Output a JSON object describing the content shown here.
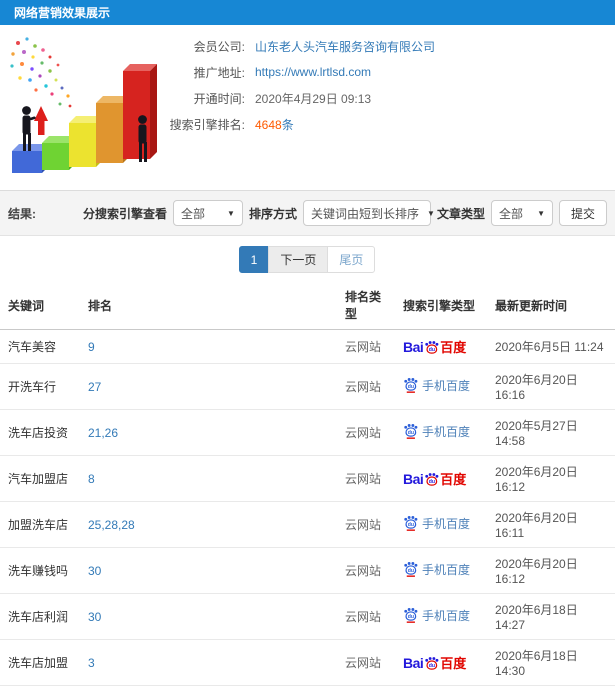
{
  "header": {
    "title": "网络营销效果展示"
  },
  "colors": {
    "topbar_blue": "#1787d4",
    "link_blue": "#337ab7",
    "count_orange": "#ff5a00",
    "baidu_blue": "#2319dc",
    "baidu_red": "#e10601",
    "mobile_icon_blue": "#2b5fd9"
  },
  "info": {
    "rows": [
      {
        "label": "会员公司:",
        "value": "山东老人头汽车服务咨询有限公司"
      },
      {
        "label": "推广地址:",
        "value": "https://www.lrtlsd.com"
      },
      {
        "label": "开通时间:",
        "value": "2020年4月29日 09:13"
      },
      {
        "label": "搜索引擎排名:",
        "value": "4648",
        "suffix": "条"
      }
    ]
  },
  "filters": {
    "result_label": "结果:",
    "engine_label": "分搜索引擎查看",
    "engine_value": "全部",
    "sort_label": "排序方式",
    "sort_value": "关键词由短到长排序",
    "article_label": "文章类型",
    "article_value": "全部",
    "submit_label": "提交"
  },
  "pagination": {
    "current": "1",
    "next_label": "下一页",
    "last_label": "尾页"
  },
  "baidu_logo": {
    "bai": "Bai",
    "du": "du",
    "cn": "百度",
    "mobile_text": "手机百度"
  },
  "table": {
    "headers": [
      "关键词",
      "排名",
      "排名类型",
      "搜索引擎类型",
      "最新更新时间"
    ],
    "rows": [
      {
        "keyword": "汽车美容",
        "rank": "9",
        "rank_type": "云网站",
        "engine": "baidu-pc",
        "updated": "2020年6月5日 11:24"
      },
      {
        "keyword": "开洗车行",
        "rank": "27",
        "rank_type": "云网站",
        "engine": "baidu-mobile",
        "updated": "2020年6月20日 16:16"
      },
      {
        "keyword": "洗车店投资",
        "rank": "21,26",
        "rank_type": "云网站",
        "engine": "baidu-mobile",
        "updated": "2020年5月27日 14:58"
      },
      {
        "keyword": "汽车加盟店",
        "rank": "8",
        "rank_type": "云网站",
        "engine": "baidu-pc",
        "updated": "2020年6月20日 16:12"
      },
      {
        "keyword": "加盟洗车店",
        "rank": "25,28,28",
        "rank_type": "云网站",
        "engine": "baidu-mobile",
        "updated": "2020年6月20日 16:11"
      },
      {
        "keyword": "洗车赚钱吗",
        "rank": "30",
        "rank_type": "云网站",
        "engine": "baidu-mobile",
        "updated": "2020年6月20日 16:12"
      },
      {
        "keyword": "洗车店利润",
        "rank": "30",
        "rank_type": "云网站",
        "engine": "baidu-mobile",
        "updated": "2020年6月18日 14:27"
      },
      {
        "keyword": "洗车店加盟",
        "rank": "3",
        "rank_type": "云网站",
        "engine": "baidu-pc",
        "updated": "2020年6月18日 14:30"
      }
    ]
  }
}
